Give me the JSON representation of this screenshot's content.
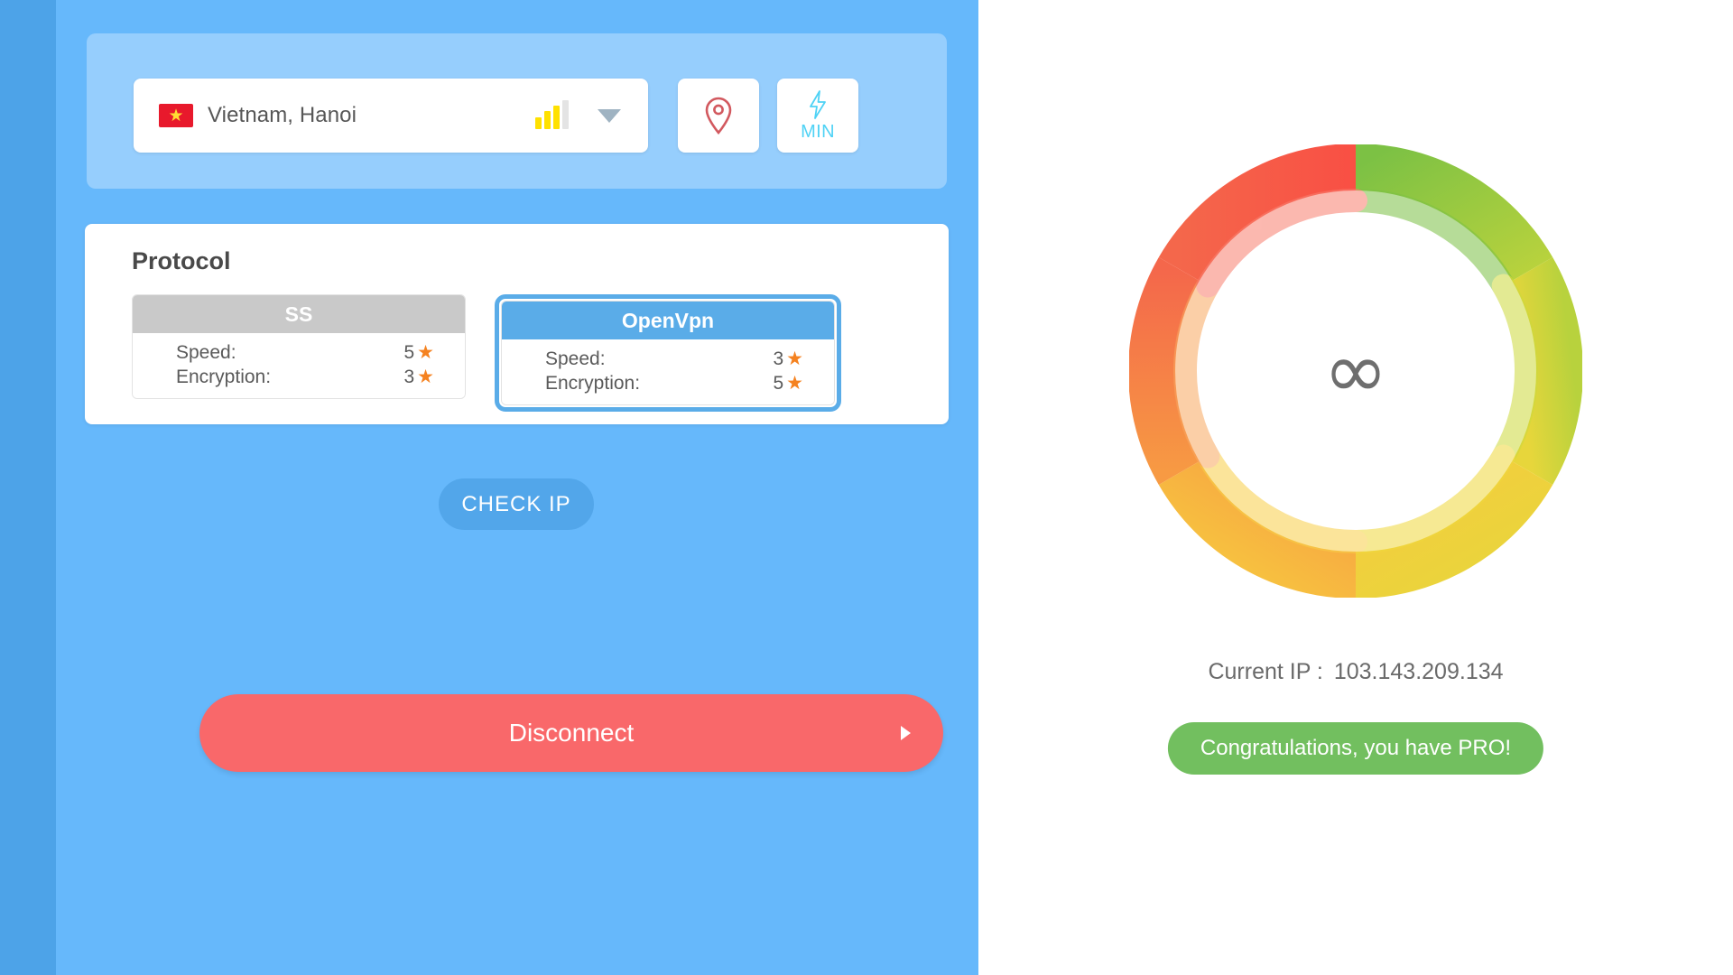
{
  "theme": {
    "rail_blue": "#4da3e8",
    "panel_blue": "#66b8fb",
    "card_blue": "#96cefd",
    "accent_blue": "#5aace8",
    "disconnect_red": "#f9686a",
    "pro_green": "#72bf5f",
    "star_orange": "#f58220",
    "signal_yellow": "#ffe100",
    "min_cyan": "#4fd2f5",
    "pin_red": "#d2595f"
  },
  "server": {
    "flag_icon": "vietnam-flag-icon",
    "flag_star": "★",
    "name": "Vietnam, Hanoi",
    "signal_bars_active": 3,
    "signal_bars_total": 4,
    "dropdown_icon": "chevron-down-icon",
    "pin_button": {
      "icon": "location-pin-icon",
      "label": ""
    },
    "min_button": {
      "icon": "lightning-bolt-icon",
      "label": "MIN"
    }
  },
  "protocol": {
    "title": "Protocol",
    "options": [
      {
        "name": "SS",
        "selected": false,
        "rows": [
          {
            "label": "Speed:",
            "value": "5",
            "star": "★"
          },
          {
            "label": "Encryption:",
            "value": "3",
            "star": "★"
          }
        ]
      },
      {
        "name": "OpenVpn",
        "selected": true,
        "rows": [
          {
            "label": "Speed:",
            "value": "3",
            "star": "★"
          },
          {
            "label": "Encryption:",
            "value": "5",
            "star": "★"
          }
        ]
      }
    ]
  },
  "actions": {
    "check_ip_label": "CHECK IP",
    "disconnect_label": "Disconnect",
    "disconnect_arrow_icon": "play-arrow-icon"
  },
  "status": {
    "gauge": {
      "center_icon": "infinity-icon",
      "center_symbol": "∞",
      "ring_colors": [
        "#7cc144",
        "#b6d13e",
        "#e3d43c",
        "#f6c93f",
        "#f79a43",
        "#f4624a",
        "#f64b42"
      ],
      "sweep_degrees": 360
    },
    "current_ip_label": "Current IP :",
    "current_ip_value": "103.143.209.134",
    "pro_badge_label": "Congratulations, you have PRO!"
  }
}
